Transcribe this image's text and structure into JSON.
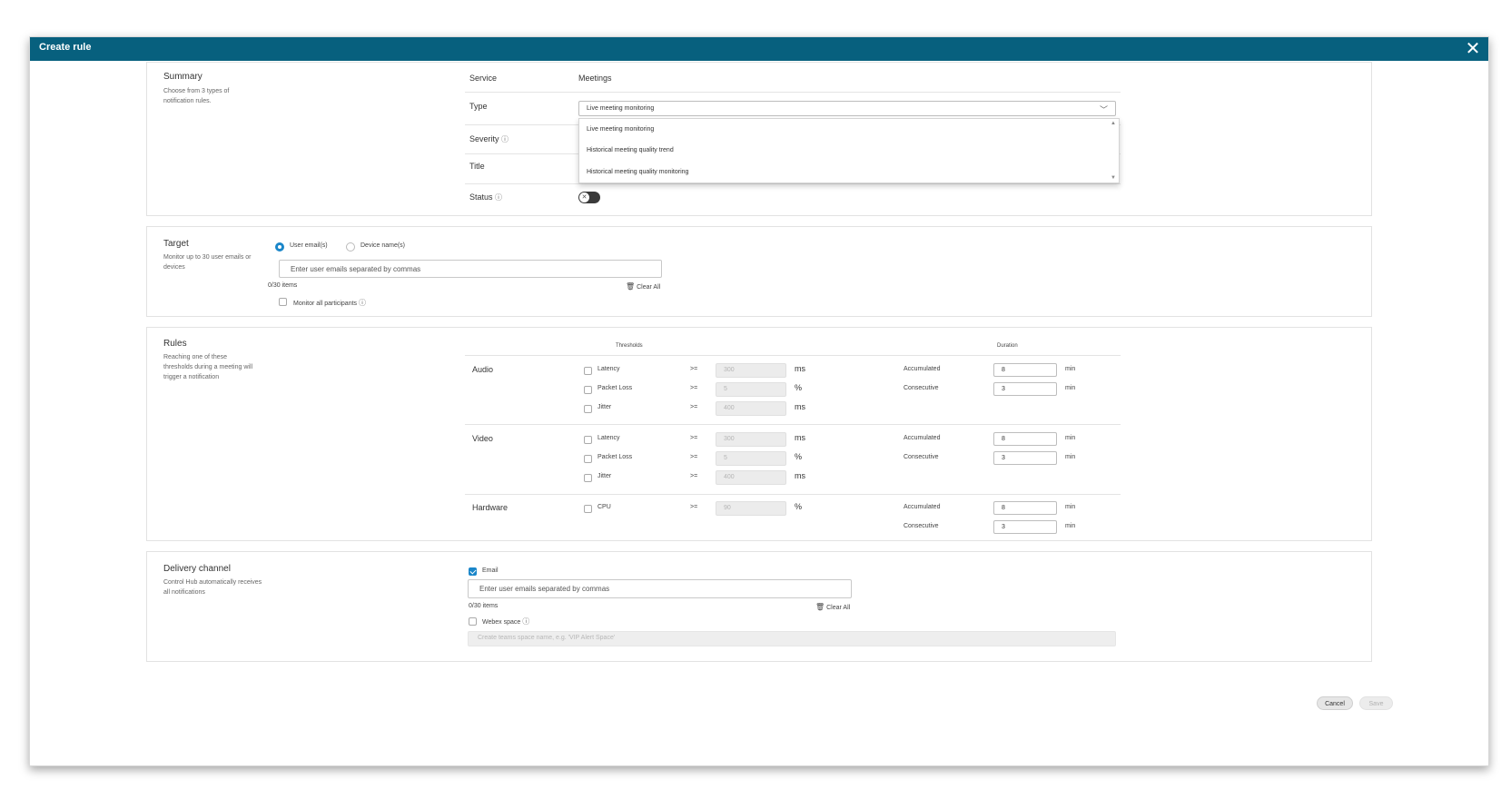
{
  "modal": {
    "title": "Create rule"
  },
  "summary": {
    "title": "Summary",
    "description": "Choose from 3 types of notification rules.",
    "service_label": "Service",
    "service_value": "Meetings",
    "type_label": "Type",
    "type_value": "Live meeting monitoring",
    "type_options": [
      "Live meeting monitoring",
      "Historical meeting quality trend",
      "Historical meeting quality monitoring"
    ],
    "severity_label": "Severity",
    "title_label": "Title",
    "status_label": "Status"
  },
  "target": {
    "title": "Target",
    "description": "Monitor up to 30 user emails or devices",
    "option_users": "User email(s)",
    "option_devices": "Device name(s)",
    "input_placeholder": "Enter user emails separated by commas",
    "count": "0/30 items",
    "clear_all": "Clear All",
    "monitor_all": "Monitor all participants"
  },
  "rules": {
    "title": "Rules",
    "description": "Reaching one of these thresholds during a meeting will trigger a notification",
    "thresholds_header": "Thresholds",
    "duration_header": "Duration",
    "operator": ">=",
    "accumulated_label": "Accumulated",
    "consecutive_label": "Consecutive",
    "min_unit": "min",
    "groups": [
      {
        "name": "Audio",
        "metrics": [
          {
            "name": "Latency",
            "value": "300",
            "unit": "ms"
          },
          {
            "name": "Packet Loss",
            "value": "5",
            "unit": "%"
          },
          {
            "name": "Jitter",
            "value": "400",
            "unit": "ms"
          }
        ],
        "accumulated": "8",
        "consecutive": "3"
      },
      {
        "name": "Video",
        "metrics": [
          {
            "name": "Latency",
            "value": "300",
            "unit": "ms"
          },
          {
            "name": "Packet Loss",
            "value": "5",
            "unit": "%"
          },
          {
            "name": "Jitter",
            "value": "400",
            "unit": "ms"
          }
        ],
        "accumulated": "8",
        "consecutive": "3"
      },
      {
        "name": "Hardware",
        "metrics": [
          {
            "name": "CPU",
            "value": "90",
            "unit": "%"
          }
        ],
        "accumulated": "8",
        "consecutive": "3"
      }
    ]
  },
  "delivery": {
    "title": "Delivery channel",
    "description": "Control Hub automatically receives all notifications",
    "email_label": "Email",
    "email_placeholder": "Enter user emails separated by commas",
    "count": "0/30 items",
    "clear_all": "Clear All",
    "webex_label": "Webex space",
    "webex_placeholder": "Create teams space name, e.g. 'VIP Alert Space'"
  },
  "footer": {
    "cancel": "Cancel",
    "save": "Save"
  },
  "colors": {
    "titlebar": "#07607e",
    "accent": "#1a86c9"
  }
}
